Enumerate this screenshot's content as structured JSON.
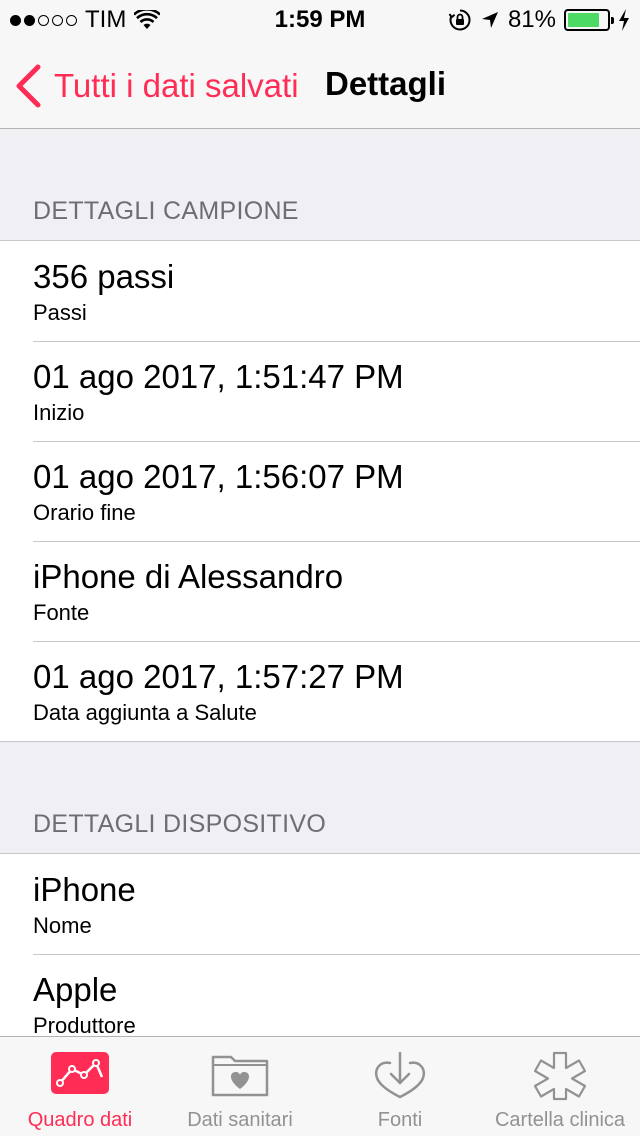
{
  "status_bar": {
    "carrier": "TIM",
    "time": "1:59 PM",
    "battery_percent": "81%",
    "battery_level": 0.81,
    "signal_bars_filled": 2,
    "signal_bars_total": 5
  },
  "nav": {
    "back_label": "Tutti i dati salvati",
    "title": "Dettagli"
  },
  "sections": [
    {
      "header": "DETTAGLI CAMPIONE",
      "rows": [
        {
          "value": "356 passi",
          "label": "Passi"
        },
        {
          "value": "01 ago 2017, 1:51:47 PM",
          "label": "Inizio"
        },
        {
          "value": "01 ago 2017, 1:56:07 PM",
          "label": "Orario fine"
        },
        {
          "value": "iPhone di Alessandro",
          "label": "Fonte"
        },
        {
          "value": "01 ago 2017, 1:57:27 PM",
          "label": "Data aggiunta a Salute"
        }
      ]
    },
    {
      "header": "DETTAGLI DISPOSITIVO",
      "rows": [
        {
          "value": "iPhone",
          "label": "Nome"
        },
        {
          "value": "Apple",
          "label": "Produttore"
        }
      ]
    }
  ],
  "tabs": [
    {
      "label": "Quadro dati",
      "icon": "dashboard-chart-icon",
      "active": true
    },
    {
      "label": "Dati sanitari",
      "icon": "health-data-folder-icon",
      "active": false
    },
    {
      "label": "Fonti",
      "icon": "sources-download-heart-icon",
      "active": false
    },
    {
      "label": "Cartella clinica",
      "icon": "medical-id-asterisk-icon",
      "active": false
    }
  ],
  "colors": {
    "accent": "#ff2d55",
    "battery": "#4cd964",
    "inactive_tab": "#929292",
    "section_header_text": "#6d6d72",
    "background": "#efeff4"
  }
}
